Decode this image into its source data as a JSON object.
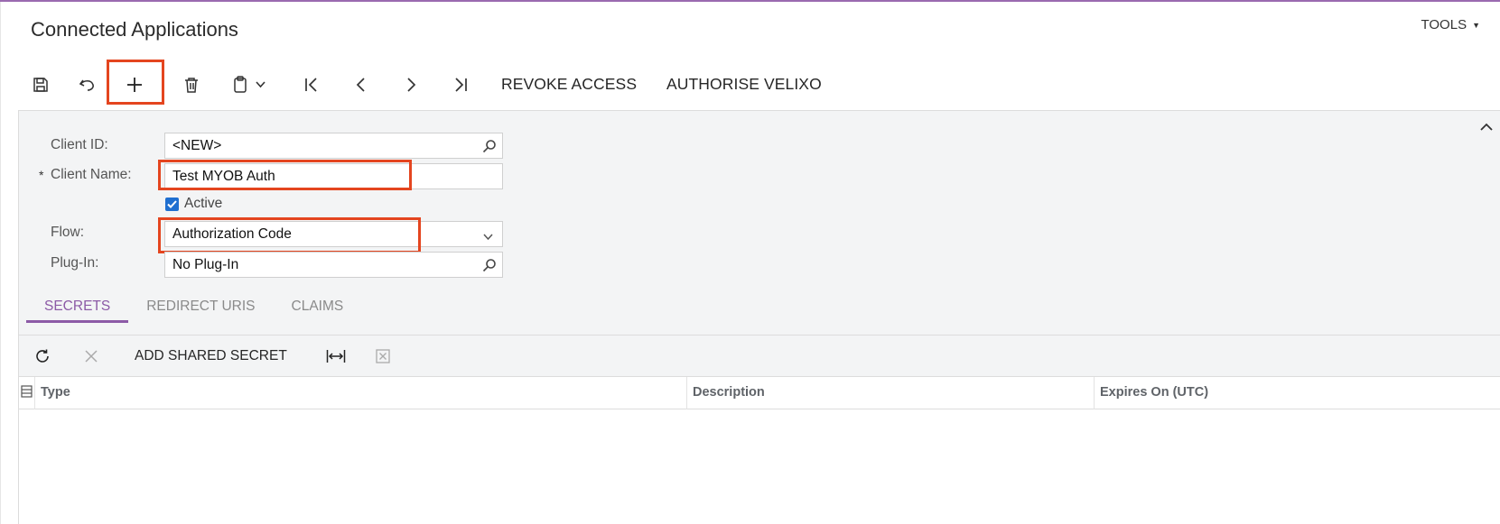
{
  "page": {
    "title": "Connected Applications",
    "tools_label": "TOOLS"
  },
  "toolbar": {
    "revoke_label": "REVOKE ACCESS",
    "authorise_label": "AUTHORISE VELIXO"
  },
  "form": {
    "client_id": {
      "label": "Client ID:",
      "value": "<NEW>"
    },
    "client_name": {
      "label": "Client Name:",
      "required_mark": "*",
      "value": "Test MYOB Auth"
    },
    "active": {
      "label": "Active",
      "checked": true
    },
    "flow": {
      "label": "Flow:",
      "value": "Authorization Code"
    },
    "plugin": {
      "label": "Plug-In:",
      "value": "No Plug-In"
    }
  },
  "tabs": [
    {
      "label": "SECRETS",
      "active": true
    },
    {
      "label": "REDIRECT URIS",
      "active": false
    },
    {
      "label": "CLAIMS",
      "active": false
    }
  ],
  "grid_toolbar": {
    "add_shared_secret_label": "ADD SHARED SECRET"
  },
  "grid": {
    "columns": [
      "Type",
      "Description",
      "Expires On (UTC)"
    ],
    "rows": []
  },
  "colors": {
    "accent_purple": "#8c5aa6",
    "highlight_red": "#e4451f",
    "checkbox_blue": "#1f6fd0"
  },
  "icons": [
    "save-icon",
    "undo-icon",
    "plus-icon",
    "trash-icon",
    "clipboard-icon",
    "chevron-down-icon",
    "first-page-icon",
    "prev-icon",
    "next-icon",
    "last-page-icon",
    "search-icon",
    "refresh-icon",
    "close-icon",
    "fit-width-icon",
    "excel-icon",
    "collapse-icon",
    "column-settings-icon"
  ]
}
